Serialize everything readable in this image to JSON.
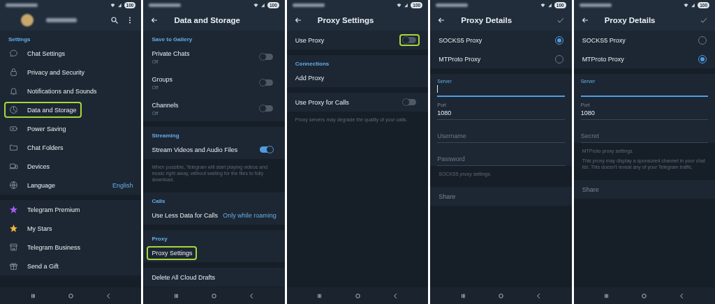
{
  "screens": [
    {
      "status_bar": {
        "battery": "100"
      },
      "header": {
        "kind": "profile"
      },
      "sections": [
        {
          "heading": "Settings",
          "rows": [
            {
              "kind": "menu",
              "label": "Chat Settings",
              "highlighted": false
            },
            {
              "kind": "menu",
              "label": "Privacy and Security",
              "highlighted": false
            },
            {
              "kind": "menu",
              "label": "Notifications and Sounds",
              "highlighted": false
            },
            {
              "kind": "menu",
              "label": "Data and Storage",
              "highlighted": true
            },
            {
              "kind": "menu",
              "label": "Power Saving",
              "highlighted": false
            },
            {
              "kind": "menu",
              "label": "Chat Folders",
              "highlighted": false
            },
            {
              "kind": "menu",
              "label": "Devices",
              "highlighted": false
            },
            {
              "kind": "menu",
              "label": "Language",
              "value": "English",
              "highlighted": false
            }
          ]
        },
        {
          "rows": [
            {
              "kind": "menu",
              "label": "Telegram Premium",
              "highlighted": false
            },
            {
              "kind": "menu",
              "label": "My Stars",
              "highlighted": false
            },
            {
              "kind": "menu",
              "label": "Telegram Business",
              "highlighted": false
            },
            {
              "kind": "menu",
              "label": "Send a Gift",
              "highlighted": false
            }
          ]
        }
      ]
    },
    {
      "status_bar": {
        "battery": "100"
      },
      "header": {
        "kind": "title",
        "title": "Data and Storage",
        "confirm": false
      },
      "sections": [
        {
          "heading": "Save to Gallery",
          "rows": [
            {
              "kind": "toggle",
              "label": "Private Chats",
              "sublabel": "Off",
              "on": false,
              "highlighted": false
            },
            {
              "kind": "toggle",
              "label": "Groups",
              "sublabel": "Off",
              "on": false,
              "highlighted": false
            },
            {
              "kind": "toggle",
              "label": "Channels",
              "sublabel": "Off",
              "on": false,
              "highlighted": false
            }
          ]
        },
        {
          "heading": "Streaming",
          "rows": [
            {
              "kind": "toggle",
              "label": "Stream Videos and Audio Files",
              "on": true,
              "highlighted": false
            }
          ],
          "note": [
            "When possible, Telegram will start playing videos and music right away, without waiting for the files to fully download."
          ]
        },
        {
          "heading": "Calls",
          "rows": [
            {
              "kind": "value",
              "label": "Use Less Data for Calls",
              "value": "Only while roaming"
            }
          ]
        },
        {
          "heading": "Proxy",
          "rows": [
            {
              "kind": "plain",
              "label": "Proxy Settings",
              "highlighted": true,
              "disabled": false
            }
          ]
        },
        {
          "rows": [
            {
              "kind": "plain",
              "label": "Delete All Cloud Drafts",
              "highlighted": false,
              "disabled": false
            }
          ]
        }
      ]
    },
    {
      "status_bar": {
        "battery": "100"
      },
      "header": {
        "kind": "title",
        "title": "Proxy Settings",
        "confirm": false
      },
      "sections": [
        {
          "rows": [
            {
              "kind": "toggle",
              "label": "Use Proxy",
              "on": false,
              "highlighted": true
            }
          ]
        },
        {
          "heading": "Connections",
          "rows": [
            {
              "kind": "plain",
              "label": "Add Proxy",
              "highlighted": false,
              "disabled": false
            }
          ]
        },
        {
          "rows": [
            {
              "kind": "toggle",
              "label": "Use Proxy for Calls",
              "on": false,
              "highlighted": false
            }
          ],
          "note": [
            "Proxy servers may degrade the quality of your calls."
          ]
        }
      ]
    },
    {
      "status_bar": {
        "battery": "100"
      },
      "header": {
        "kind": "title",
        "title": "Proxy Details",
        "confirm": true
      },
      "sections": [
        {
          "rows": [
            {
              "kind": "radio",
              "label": "SOCKS5 Proxy",
              "selected": true
            },
            {
              "kind": "radio",
              "label": "MTProto Proxy",
              "selected": false
            }
          ]
        },
        {
          "rows": [
            {
              "kind": "field",
              "label": "Server",
              "focused": true,
              "cursor": true
            },
            {
              "kind": "field",
              "label": "Port",
              "value": "1080",
              "focused": false,
              "cursor": false
            },
            {
              "kind": "field",
              "placeholder": "Username",
              "focused": false,
              "cursor": false
            },
            {
              "kind": "field",
              "placeholder": "Password",
              "focused": false,
              "cursor": false
            }
          ],
          "note": [
            "SOCKS5 proxy settings."
          ]
        },
        {
          "rows": [
            {
              "kind": "plain",
              "label": "Share",
              "highlighted": false,
              "disabled": true
            }
          ]
        }
      ]
    },
    {
      "status_bar": {
        "battery": "100"
      },
      "header": {
        "kind": "title",
        "title": "Proxy Details",
        "confirm": true
      },
      "sections": [
        {
          "rows": [
            {
              "kind": "radio",
              "label": "SOCKS5 Proxy",
              "selected": false
            },
            {
              "kind": "radio",
              "label": "MTProto Proxy",
              "selected": true
            }
          ]
        },
        {
          "rows": [
            {
              "kind": "field",
              "label": "Server",
              "focused": true,
              "cursor": false
            },
            {
              "kind": "field",
              "label": "Port",
              "value": "1080",
              "focused": false,
              "cursor": false
            },
            {
              "kind": "field",
              "placeholder": "Secret",
              "focused": false,
              "cursor": false
            }
          ],
          "note": [
            "MTProto proxy settings.",
            "This proxy may display a sponsored channel in your chat list. This doesn't reveal any of your Telegram traffic."
          ]
        },
        {
          "rows": [
            {
              "kind": "plain",
              "label": "Share",
              "highlighted": false,
              "disabled": true
            }
          ]
        }
      ]
    }
  ]
}
